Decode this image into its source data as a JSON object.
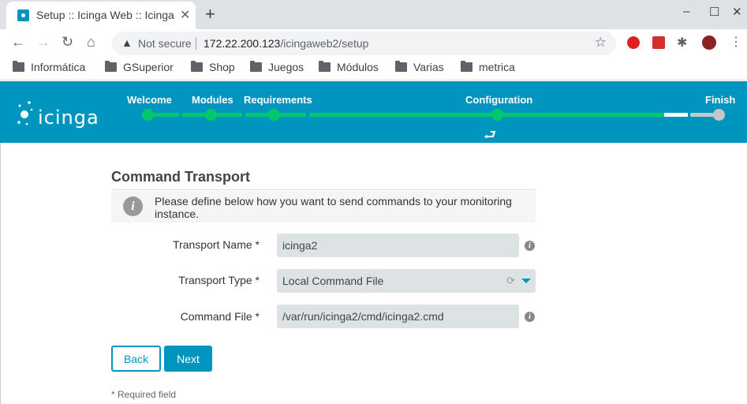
{
  "browser": {
    "tab_title": "Setup :: Icinga Web :: Icinga",
    "not_secure": "Not secure",
    "url_host": "172.22.200.123",
    "url_path": "/icingaweb2/setup",
    "bookmarks": [
      "Informática",
      "GSuperior",
      "Shop",
      "Juegos",
      "Módulos",
      "Varias",
      "metrica"
    ]
  },
  "header": {
    "logo": "icinga",
    "steps": {
      "welcome": "Welcome",
      "modules": "Modules",
      "requirements": "Requirements",
      "configuration": "Configuration",
      "finish": "Finish"
    }
  },
  "form": {
    "title": "Command Transport",
    "info": "Please define below how you want to send commands to your monitoring instance.",
    "transport_name_label": "Transport Name *",
    "transport_name_value": "icinga2",
    "transport_type_label": "Transport Type *",
    "transport_type_value": "Local Command File",
    "command_file_label": "Command File *",
    "command_file_value": "/var/run/icinga2/cmd/icinga2.cmd",
    "back_label": "Back",
    "next_label": "Next",
    "required_note": "* Required field"
  },
  "colors": {
    "brand": "#0095bf",
    "progress": "#00c96b",
    "input_bg": "#dde3e5"
  }
}
